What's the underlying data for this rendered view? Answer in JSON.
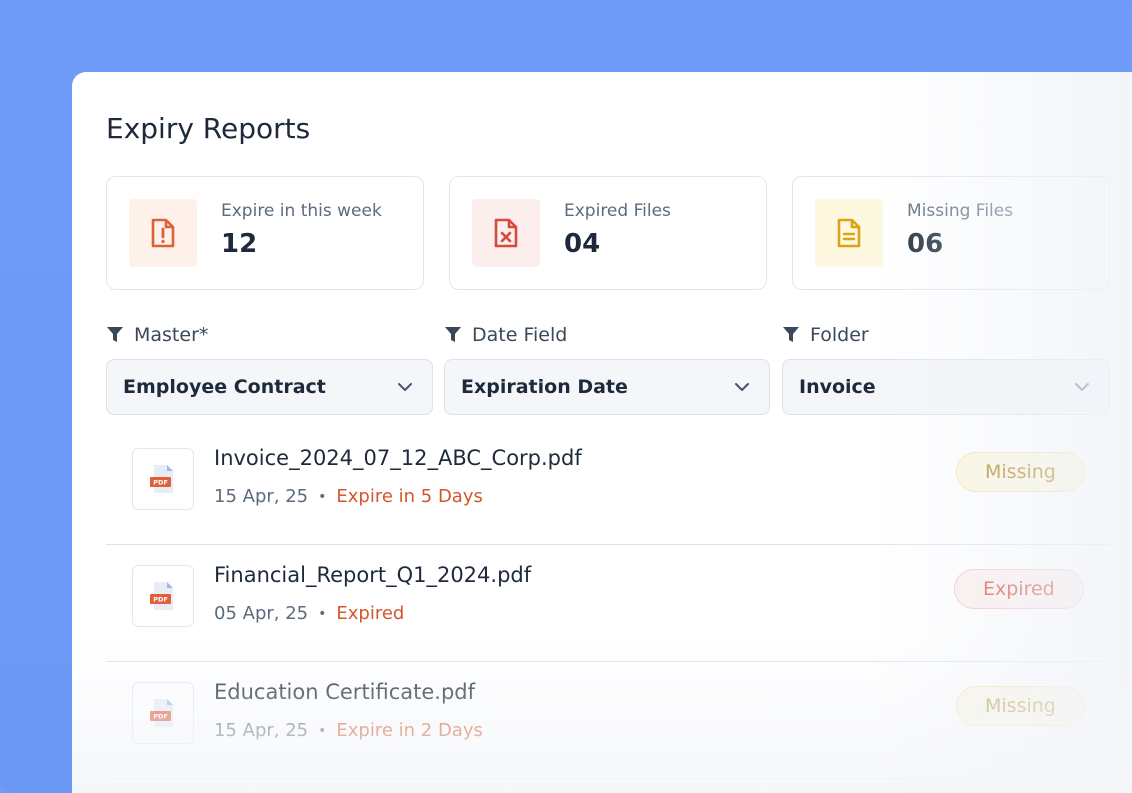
{
  "page": {
    "title": "Expiry Reports"
  },
  "stats": [
    {
      "label": "Expire in this week",
      "value": "12",
      "icon": "file-alert-icon",
      "icon_color": "#e0603a",
      "icon_bg": "#fdf1ea"
    },
    {
      "label": "Expired Files",
      "value": "04",
      "icon": "file-x-icon",
      "icon_color": "#d64a3a",
      "icon_bg": "#fdeeee"
    },
    {
      "label": "Missing Files",
      "value": "06",
      "icon": "file-text-icon",
      "icon_color": "#d9a514",
      "icon_bg": "#fdf8df"
    }
  ],
  "filters": [
    {
      "label": "Master*",
      "value": "Employee Contract"
    },
    {
      "label": "Date Field",
      "value": "Expiration Date"
    },
    {
      "label": "Folder",
      "value": "Invoice"
    }
  ],
  "files": [
    {
      "name": "Invoice_2024_07_12_ABC_Corp.pdf",
      "date": "15 Apr, 25",
      "expiry": "Expire in 5 Days",
      "status": "Missing",
      "icon_text": "PDF"
    },
    {
      "name": "Financial_Report_Q1_2024.pdf",
      "date": "05 Apr, 25",
      "expiry": "Expired",
      "status": "Expired",
      "icon_text": "PDF"
    },
    {
      "name": "Education Certificate.pdf",
      "date": "15 Apr, 25",
      "expiry": "Expire in 2 Days",
      "status": "Missing",
      "icon_text": "PDF"
    }
  ],
  "meta_separator": "•",
  "colors": {
    "background": "#6f9bf6",
    "accent_orange": "#d4572a",
    "missing": "#a77a0e",
    "expired": "#d64a3a"
  }
}
